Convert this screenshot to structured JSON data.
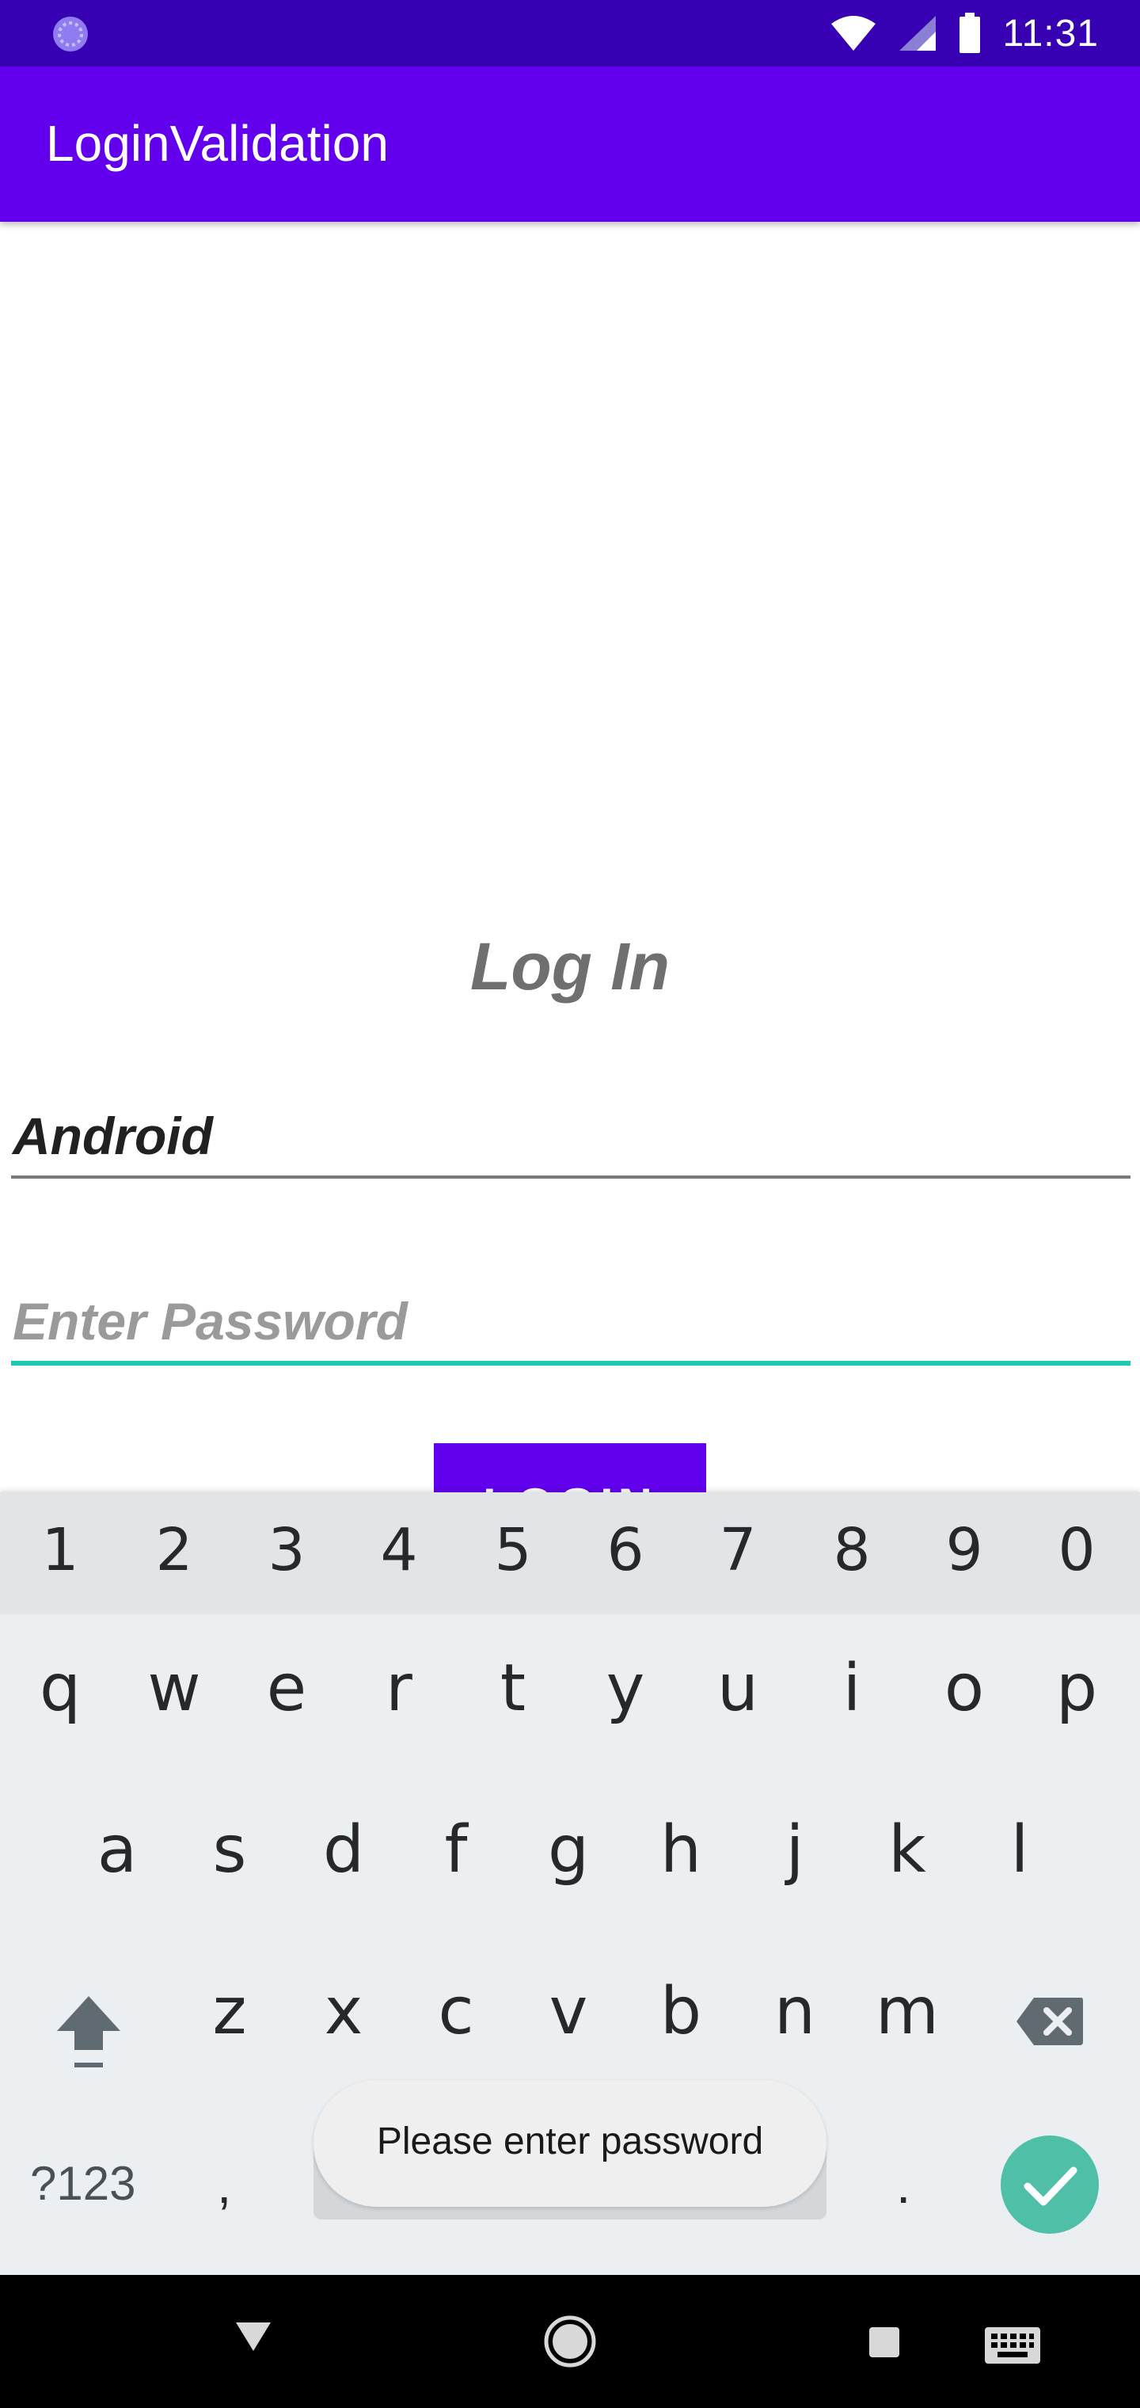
{
  "status_bar": {
    "time": "11:31",
    "left_icon": "notification-spinner-icon",
    "icons": [
      "wifi-icon",
      "cellular-signal-icon",
      "battery-icon"
    ],
    "background": "#3700b3"
  },
  "app_bar": {
    "title": "LoginValidation",
    "background": "#6200ee"
  },
  "form": {
    "heading": "Log In",
    "username_value": "Android",
    "password_placeholder": "Enter Password",
    "password_underline_color": "#1ec9b4",
    "login_button_label": "LOGIN"
  },
  "keyboard": {
    "number_row": [
      "1",
      "2",
      "3",
      "4",
      "5",
      "6",
      "7",
      "8",
      "9",
      "0"
    ],
    "row1": [
      "q",
      "w",
      "e",
      "r",
      "t",
      "y",
      "u",
      "i",
      "o",
      "p"
    ],
    "row2": [
      "a",
      "s",
      "d",
      "f",
      "g",
      "h",
      "j",
      "k",
      "l"
    ],
    "row3": [
      "z",
      "x",
      "c",
      "v",
      "b",
      "n",
      "m"
    ],
    "symbols_label": "?123",
    "comma_label": ",",
    "period_label": ".",
    "shift_icon": "shift-icon",
    "backspace_icon": "backspace-icon",
    "enter_icon": "checkmark-icon",
    "enter_color": "#4fbfa8"
  },
  "toast": {
    "message": "Please enter password"
  },
  "nav_bar": {
    "icons": [
      "back-triangle-icon",
      "home-circle-icon",
      "recents-square-icon",
      "keyboard-switch-icon"
    ]
  }
}
